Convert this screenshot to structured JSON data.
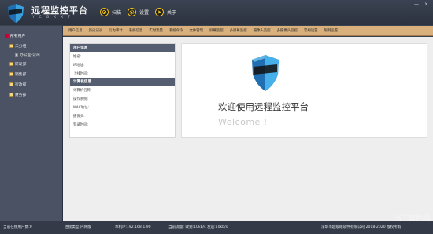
{
  "app": {
    "title": "远程监控平台",
    "subtitle": "YCGKXT"
  },
  "header_buttons": [
    {
      "label": "扫描"
    },
    {
      "label": "设置"
    },
    {
      "label": "关于"
    }
  ],
  "window_controls": {
    "minimize": "—",
    "close": "×"
  },
  "menu": [
    "用户信息",
    "历史记录",
    "行为审计",
    "系统信息",
    "实时流量",
    "系统命令",
    "文件管理",
    "屏幕监控",
    "多屏幕监控",
    "摄像头监控",
    "多摄像头监控",
    "常规设置",
    "限制设置"
  ],
  "sidebar": {
    "items": [
      {
        "label": "所有用户"
      },
      {
        "label": "未分组"
      },
      {
        "label": "办公室-公司"
      },
      {
        "label": "研发部"
      },
      {
        "label": "销售部"
      },
      {
        "label": "行政部"
      },
      {
        "label": "财务部"
      }
    ]
  },
  "info_panel": {
    "user_section": "用户信息",
    "user_rows": [
      "姓名:",
      "IP地址:",
      "上线时间:"
    ],
    "computer_section": "计算机信息",
    "computer_rows": [
      "计算机名称:",
      "操作系统:",
      "MAC地址:",
      "摄像头:",
      "登录时间:"
    ]
  },
  "welcome": {
    "title": "欢迎使用远程监控平台",
    "subtitle": "Welcome !"
  },
  "status": {
    "online": "当前在线用户数:0",
    "conn": "连接类型:内网版",
    "ip": "本机IP:192.168.1.90",
    "traffic": "当前流量: 收到:10kb/s    发送:10kb/s",
    "copyright": "深圳市超级眼软件有限公司 2018-2020 版权所有"
  },
  "watermark": "当下软件园",
  "colors": {
    "accent": "#f2c11a",
    "menubar": "#d9b07c",
    "sidebar": "#4a5264",
    "section_head": "#545e70"
  }
}
